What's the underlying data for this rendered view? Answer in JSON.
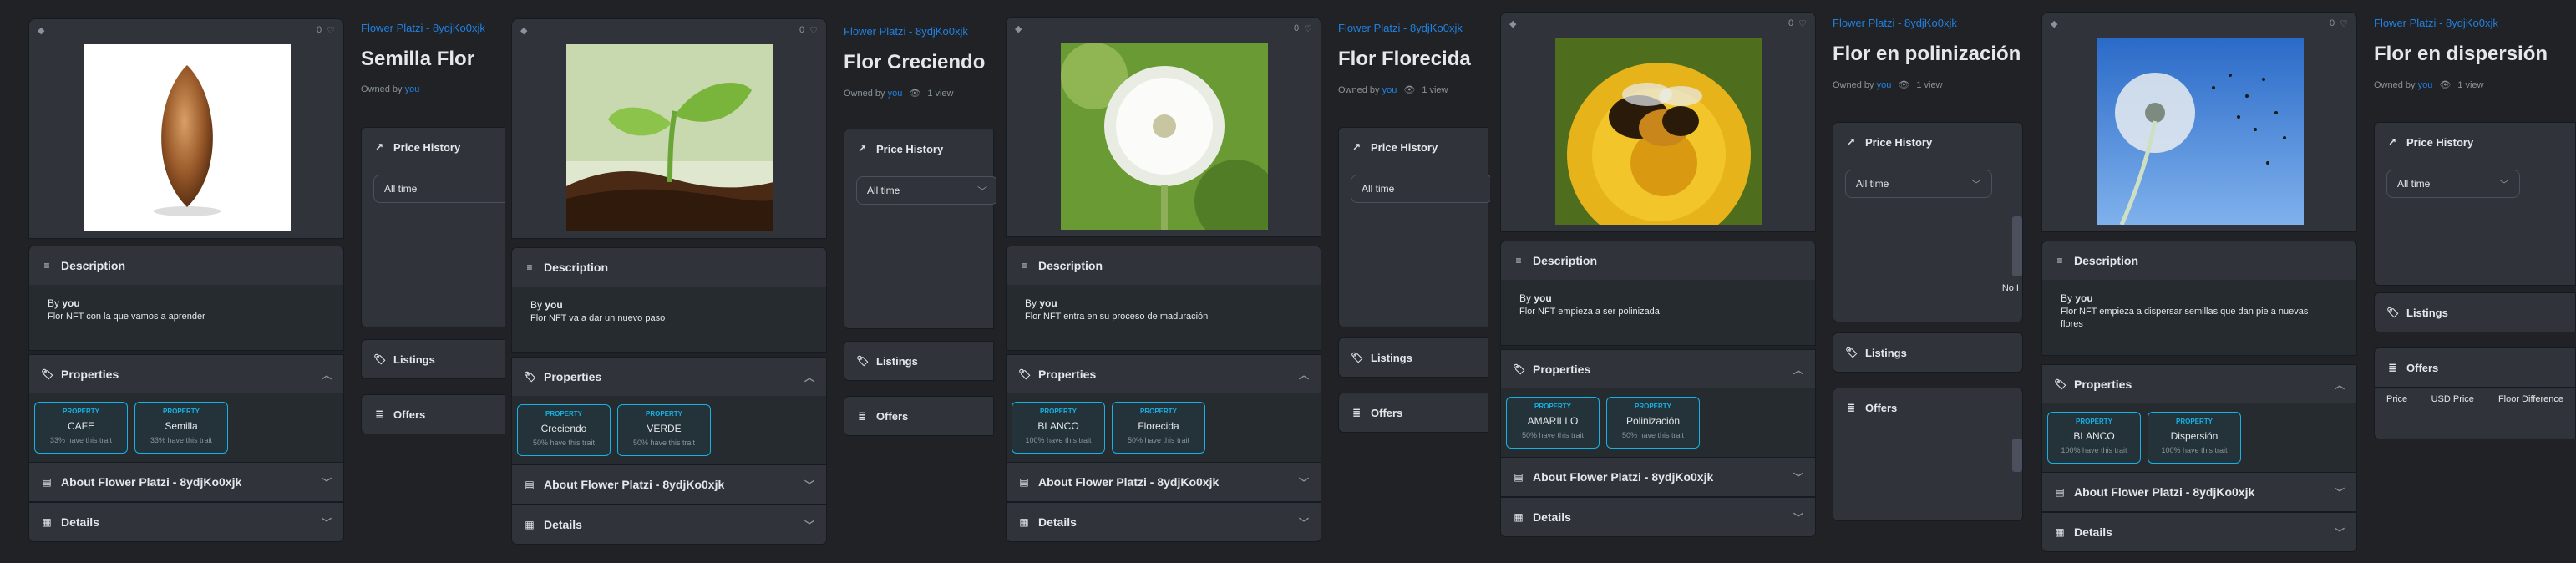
{
  "panels": [
    {
      "collection": "Flower Platzi - 8ydjKo0xjk",
      "title": "Semilla Flor",
      "owned_prefix": "Owned by",
      "owner": "you",
      "views": "",
      "likes": "0",
      "description_label": "Description",
      "by_prefix": "By",
      "by_user": "you",
      "description": "Flor NFT con la que vamos a aprender",
      "properties_label": "Properties",
      "properties": [
        {
          "type": "PROPERTY",
          "value": "CAFE",
          "rarity": "33% have this trait"
        },
        {
          "type": "PROPERTY",
          "value": "Semilla",
          "rarity": "33% have this trait"
        }
      ],
      "about_label": "About Flower Platzi - 8ydjKo0xjk",
      "details_label": "Details",
      "price_history": "Price History",
      "all_time": "All time",
      "listings": "Listings",
      "offers": "Offers",
      "image": "almond-seed"
    },
    {
      "collection": "Flower Platzi - 8ydjKo0xjk",
      "title": "Flor Creciendo",
      "owned_prefix": "Owned by",
      "owner": "you",
      "views": "1 view",
      "likes": "0",
      "description_label": "Description",
      "by_prefix": "By",
      "by_user": "you",
      "description": "Flor NFT va a dar un nuevo paso",
      "properties_label": "Properties",
      "properties": [
        {
          "type": "PROPERTY",
          "value": "Creciendo",
          "rarity": "50% have this trait"
        },
        {
          "type": "PROPERTY",
          "value": "VERDE",
          "rarity": "50% have this trait"
        }
      ],
      "about_label": "About Flower Platzi - 8ydjKo0xjk",
      "details_label": "Details",
      "price_history": "Price History",
      "all_time": "All time",
      "listings": "Listings",
      "offers": "Offers",
      "image": "sprout"
    },
    {
      "collection": "Flower Platzi - 8ydjKo0xjk",
      "title": "Flor Florecida",
      "owned_prefix": "Owned by",
      "owner": "you",
      "views": "1 view",
      "likes": "0",
      "description_label": "Description",
      "by_prefix": "By",
      "by_user": "you",
      "description": "Flor NFT entra en su proceso de maduración",
      "properties_label": "Properties",
      "properties": [
        {
          "type": "PROPERTY",
          "value": "BLANCO",
          "rarity": "100% have this trait"
        },
        {
          "type": "PROPERTY",
          "value": "Florecida",
          "rarity": "50% have this trait"
        }
      ],
      "about_label": "About Flower Platzi - 8ydjKo0xjk",
      "details_label": "Details",
      "price_history": "Price History",
      "all_time": "All time",
      "listings": "Listings",
      "offers": "Offers",
      "image": "dandelion"
    },
    {
      "collection": "Flower Platzi - 8ydjKo0xjk",
      "title": "Flor en polinización",
      "owned_prefix": "Owned by",
      "owner": "you",
      "views": "1 view",
      "likes": "0",
      "description_label": "Description",
      "by_prefix": "By",
      "by_user": "you",
      "description": "Flor NFT empieza a ser polinizada",
      "properties_label": "Properties",
      "properties": [
        {
          "type": "PROPERTY",
          "value": "AMARILLO",
          "rarity": "50% have this trait"
        },
        {
          "type": "PROPERTY",
          "value": "Polinización",
          "rarity": "50% have this trait"
        }
      ],
      "about_label": "About Flower Platzi - 8ydjKo0xjk",
      "details_label": "Details",
      "price_history": "Price History",
      "all_time": "All time",
      "listings": "Listings",
      "offers": "Offers",
      "no_data": "No I",
      "image": "bee-flower"
    },
    {
      "collection": "Flower Platzi - 8ydjKo0xjk",
      "title": "Flor en dispersión",
      "owned_prefix": "Owned by",
      "owner": "you",
      "views": "1 view",
      "likes": "0",
      "description_label": "Description",
      "by_prefix": "By",
      "by_user": "you",
      "description": "Flor NFT empieza a dispersar semillas que dan pie a nuevas flores",
      "properties_label": "Properties",
      "properties": [
        {
          "type": "PROPERTY",
          "value": "BLANCO",
          "rarity": "100% have this trait"
        },
        {
          "type": "PROPERTY",
          "value": "Dispersión",
          "rarity": "100% have this trait"
        }
      ],
      "about_label": "About Flower Platzi - 8ydjKo0xjk",
      "details_label": "Details",
      "price_history": "Price History",
      "all_time": "All time",
      "listings": "Listings",
      "offers": "Offers",
      "offers_cols": [
        "Price",
        "USD Price",
        "Floor Difference"
      ],
      "image": "dandelion-seeds"
    }
  ],
  "colors": {
    "bg": "#202225",
    "card": "#303339",
    "accent": "#2081e2",
    "prop": "#15b2e5"
  }
}
